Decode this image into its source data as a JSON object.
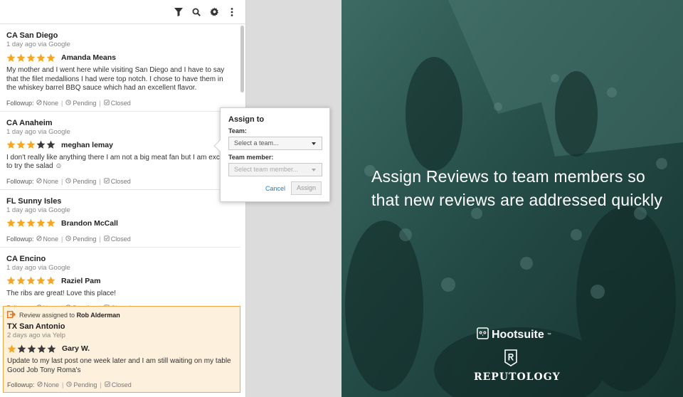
{
  "toolbar": {
    "icons": [
      "filter-icon",
      "search-icon",
      "gear-icon",
      "more-icon"
    ]
  },
  "followup_labels": {
    "label": "Followup:",
    "none": "None",
    "pending": "Pending",
    "closed": "Closed"
  },
  "reviews": [
    {
      "location": "CA San Diego",
      "meta": "1 day ago via Google",
      "rating": 5,
      "reviewer": "Amanda Means",
      "text": "My mother and I went here while visiting San Diego and I have to say that the filet medallions I had were top notch. I chose to have them in the whiskey barrel BBQ sauce which had an excellent flavor."
    },
    {
      "location": "CA Anaheim",
      "meta": "1 day ago via Google",
      "rating": 3,
      "reviewer": "meghan lemay",
      "text": "I don't really like anything there I am not a big meat fan but I am excited to try the salad ☺"
    },
    {
      "location": "FL Sunny Isles",
      "meta": "1 day ago via Google",
      "rating": 5,
      "reviewer": "Brandon McCall",
      "text": ""
    },
    {
      "location": "CA Encino",
      "meta": "1 day ago via Google",
      "rating": 5,
      "reviewer": "Raziel Pam",
      "text": "The ribs are great! Love this place!"
    }
  ],
  "assigned": {
    "note_prefix": "Review assigned to",
    "assignee": "Rob Alderman",
    "location": "TX San Antonio",
    "meta": "2 days ago via Yelp",
    "rating": 1,
    "reviewer": "Gary W.",
    "text": "Update to my last post one week later and I am still waiting on my table Good Job Tony Roma's"
  },
  "popup": {
    "title": "Assign to",
    "team_label": "Team:",
    "team_placeholder": "Select a team...",
    "member_label": "Team member:",
    "member_placeholder": "Select team member...",
    "cancel": "Cancel",
    "assign": "Assign"
  },
  "promo": {
    "headline": "Assign Reviews to team members so that new reviews are addressed quickly",
    "brand_hootsuite": "Hootsuite",
    "brand_reputology": "REPUTOLOGY"
  },
  "colors": {
    "star_on": "#f5a623",
    "star_off": "#3a3a3a",
    "assigned_bg": "#fdf0dd",
    "assigned_border": "#f0a845",
    "promo_bg": "#1e4440",
    "link": "#2a7ab8"
  }
}
